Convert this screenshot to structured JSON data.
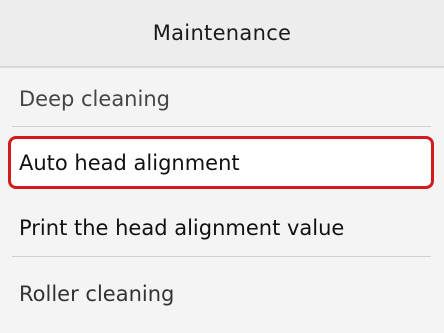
{
  "header": {
    "title": "Maintenance"
  },
  "menu": {
    "items": [
      {
        "label": "Deep cleaning"
      },
      {
        "label": "Auto head alignment",
        "selected": true
      },
      {
        "label": "Print the head alignment value"
      },
      {
        "label": "Roller cleaning"
      }
    ]
  },
  "colors": {
    "selection_border": "#d21b1b",
    "background": "#f4f4f4",
    "header_background": "#ededed"
  }
}
